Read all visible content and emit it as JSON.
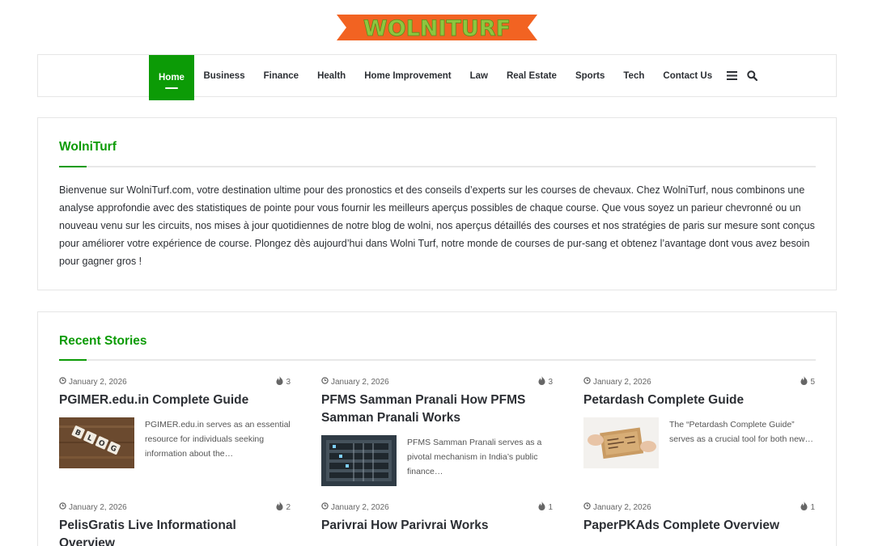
{
  "logo": {
    "text": "WOLNITURF",
    "bg_color": "#f26322",
    "text_color": "#8dc63f"
  },
  "nav": {
    "items": [
      "Home",
      "Business",
      "Finance",
      "Health",
      "Home Improvement",
      "Law",
      "Real Estate",
      "Sports",
      "Tech",
      "Contact Us"
    ],
    "active": "Home",
    "icons": [
      "menu-icon",
      "search-icon"
    ]
  },
  "theme": {
    "accent": "#0c9b06",
    "text": "#2c2f34",
    "border": "#e6e6e6"
  },
  "about": {
    "title": "WolniTurf",
    "body": "Bienvenue sur WolniTurf.com, votre destination ultime pour des pronostics et des conseils d’experts sur les courses de chevaux. Chez WolniTurf, nous combinons une analyse approfondie avec des statistiques de pointe pour vous fournir les meilleurs aperçus possibles de chaque course. Que vous soyez un parieur chevronné ou un nouveau venu sur les circuits, nos mises à jour quotidiennes de notre blog de wolni, nos aperçus détaillés des courses et nos stratégies de paris sur mesure sont conçus pour améliorer votre expérience de course. Plongez dès aujourd’hui dans Wolni Turf, notre monde de courses de pur-sang et obtenez l’avantage dont vous avez besoin pour gagner gros !"
  },
  "recent": {
    "title": "Recent Stories",
    "posts": [
      {
        "date": "January 2, 2026",
        "views": "3",
        "title": "PGIMER.edu.in Complete Guide",
        "excerpt": "PGIMER.edu.in serves as an essential resource for individuals seeking information about the…",
        "thumb": "blog-tiles-image"
      },
      {
        "date": "January 2, 2026",
        "views": "3",
        "title": "PFMS Samman Pranali How PFMS Samman Pranali Works",
        "excerpt": "PFMS Samman Pranali serves as a pivotal mechanism in India’s public finance…",
        "thumb": "server-rack-image"
      },
      {
        "date": "January 2, 2026",
        "views": "5",
        "title": "Petardash Complete Guide",
        "excerpt": "The “Petardash Complete Guide” serves as a crucial tool for both new…",
        "thumb": "cardboard-sign-image"
      },
      {
        "date": "January 2, 2026",
        "views": "2",
        "title": "PelisGratis Live Informational Overview",
        "excerpt": "",
        "thumb": ""
      },
      {
        "date": "January 2, 2026",
        "views": "1",
        "title": "Parivrai How Parivrai Works",
        "excerpt": "",
        "thumb": ""
      },
      {
        "date": "January 2, 2026",
        "views": "1",
        "title": "PaperPKAds Complete Overview",
        "excerpt": "",
        "thumb": ""
      }
    ]
  }
}
